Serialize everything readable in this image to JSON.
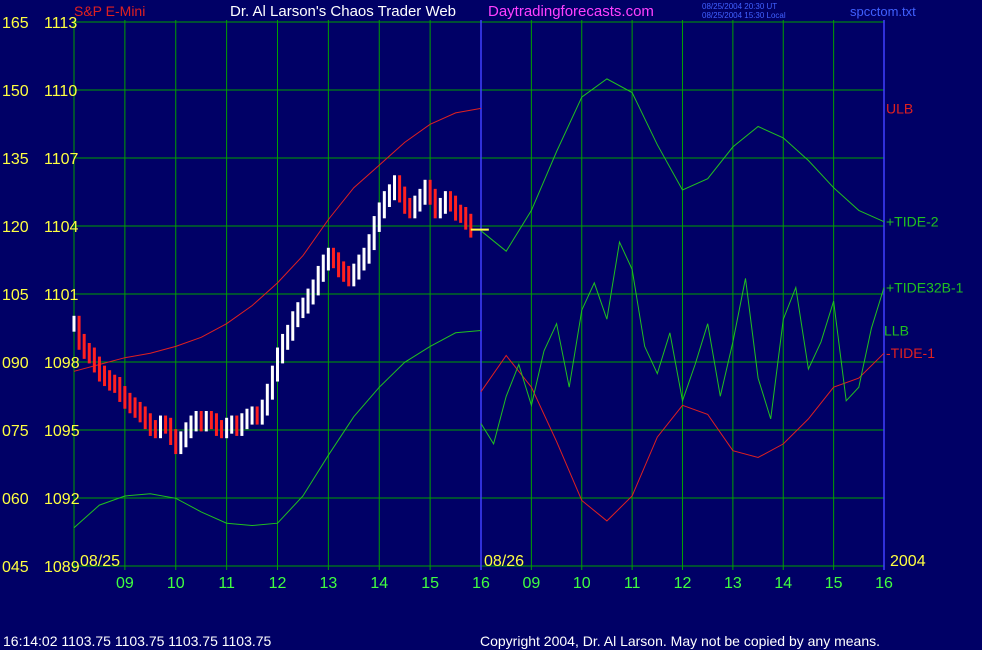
{
  "header": {
    "symbol": "S&P E-Mini",
    "title": "Dr. Al Larson's Chaos Trader Web",
    "site": "Daytradingforecasts.com",
    "timestamp_ut": "08/25/2004 20:30 UT",
    "timestamp_local": "08/25/2004 15:30 Local",
    "file": "spcctom.txt"
  },
  "footer": {
    "quote": "16:14:02  1103.75 1103.75 1103.75 1103.75",
    "copyright": "Copyright 2004, Dr. Al Larson. May not be copied by any means."
  },
  "colors": {
    "background": "#000066",
    "grid": "#00a000",
    "divider": "#4040ff",
    "bar_up": "#ffffff",
    "bar_down": "#ff2020",
    "series_red": "#e02020",
    "series_green": "#20c020",
    "series_blue": "#2040ff",
    "label_yellow": "#ffff40",
    "label_green": "#40ff40",
    "title_magenta": "#ff40ff"
  },
  "chart_data": {
    "type": "line",
    "title": "S&P E-Mini",
    "left_axis_ticks": [
      "165",
      "150",
      "135",
      "120",
      "105",
      "090",
      "075",
      "060",
      "045"
    ],
    "price_axis_ticks": [
      "1113",
      "1110",
      "1107",
      "1104",
      "1101",
      "1098",
      "1095",
      "1092",
      "1089"
    ],
    "ylim_price": [
      1089,
      1113
    ],
    "ylim_index": [
      45,
      165
    ],
    "x_ticks": [
      "09",
      "10",
      "11",
      "12",
      "13",
      "14",
      "15",
      "16",
      "09",
      "10",
      "11",
      "12",
      "13",
      "14",
      "15",
      "16"
    ],
    "day_labels": [
      "08/25",
      "08/26"
    ],
    "year": "2004",
    "last_price": 1103.75,
    "xlim_hours": [
      8.0,
      16.0
    ],
    "price_bars": [
      {
        "t": 8.0,
        "c": 1099.6
      },
      {
        "t": 8.1,
        "c": 1098.8
      },
      {
        "t": 8.2,
        "c": 1098.4
      },
      {
        "t": 8.3,
        "c": 1098.2
      },
      {
        "t": 8.4,
        "c": 1097.8
      },
      {
        "t": 8.5,
        "c": 1097.4
      },
      {
        "t": 8.6,
        "c": 1097.2
      },
      {
        "t": 8.7,
        "c": 1097.0
      },
      {
        "t": 8.8,
        "c": 1096.9
      },
      {
        "t": 8.9,
        "c": 1096.5
      },
      {
        "t": 9.0,
        "c": 1096.2
      },
      {
        "t": 9.1,
        "c": 1096.0
      },
      {
        "t": 9.2,
        "c": 1095.8
      },
      {
        "t": 9.3,
        "c": 1095.6
      },
      {
        "t": 9.4,
        "c": 1095.3
      },
      {
        "t": 9.5,
        "c": 1095.0
      },
      {
        "t": 9.6,
        "c": 1094.9
      },
      {
        "t": 9.7,
        "c": 1095.2
      },
      {
        "t": 9.8,
        "c": 1095.1
      },
      {
        "t": 9.9,
        "c": 1094.6
      },
      {
        "t": 10.0,
        "c": 1094.2
      },
      {
        "t": 10.1,
        "c": 1094.5
      },
      {
        "t": 10.2,
        "c": 1094.9
      },
      {
        "t": 10.3,
        "c": 1095.2
      },
      {
        "t": 10.4,
        "c": 1095.4
      },
      {
        "t": 10.5,
        "c": 1095.2
      },
      {
        "t": 10.6,
        "c": 1095.4
      },
      {
        "t": 10.7,
        "c": 1095.3
      },
      {
        "t": 10.8,
        "c": 1095.0
      },
      {
        "t": 10.9,
        "c": 1094.9
      },
      {
        "t": 11.0,
        "c": 1095.1
      },
      {
        "t": 11.1,
        "c": 1095.2
      },
      {
        "t": 11.2,
        "c": 1095.0
      },
      {
        "t": 11.3,
        "c": 1095.3
      },
      {
        "t": 11.4,
        "c": 1095.5
      },
      {
        "t": 11.5,
        "c": 1095.6
      },
      {
        "t": 11.6,
        "c": 1095.5
      },
      {
        "t": 11.7,
        "c": 1095.9
      },
      {
        "t": 11.8,
        "c": 1096.6
      },
      {
        "t": 11.9,
        "c": 1097.4
      },
      {
        "t": 12.0,
        "c": 1098.2
      },
      {
        "t": 12.1,
        "c": 1098.8
      },
      {
        "t": 12.2,
        "c": 1099.2
      },
      {
        "t": 12.3,
        "c": 1099.8
      },
      {
        "t": 12.4,
        "c": 1100.2
      },
      {
        "t": 12.5,
        "c": 1100.4
      },
      {
        "t": 12.6,
        "c": 1100.8
      },
      {
        "t": 12.7,
        "c": 1101.2
      },
      {
        "t": 12.8,
        "c": 1101.8
      },
      {
        "t": 12.9,
        "c": 1102.3
      },
      {
        "t": 13.0,
        "c": 1102.6
      },
      {
        "t": 13.1,
        "c": 1102.4
      },
      {
        "t": 13.2,
        "c": 1102.0
      },
      {
        "t": 13.3,
        "c": 1101.8
      },
      {
        "t": 13.4,
        "c": 1101.6
      },
      {
        "t": 13.5,
        "c": 1101.9
      },
      {
        "t": 13.6,
        "c": 1102.3
      },
      {
        "t": 13.7,
        "c": 1102.6
      },
      {
        "t": 13.8,
        "c": 1103.2
      },
      {
        "t": 13.9,
        "c": 1104.0
      },
      {
        "t": 14.0,
        "c": 1104.6
      },
      {
        "t": 14.1,
        "c": 1105.1
      },
      {
        "t": 14.2,
        "c": 1105.4
      },
      {
        "t": 14.3,
        "c": 1105.8
      },
      {
        "t": 14.4,
        "c": 1105.3
      },
      {
        "t": 14.5,
        "c": 1104.8
      },
      {
        "t": 14.6,
        "c": 1104.6
      },
      {
        "t": 14.7,
        "c": 1104.9
      },
      {
        "t": 14.8,
        "c": 1105.2
      },
      {
        "t": 14.9,
        "c": 1105.6
      },
      {
        "t": 15.0,
        "c": 1105.2
      },
      {
        "t": 15.1,
        "c": 1104.6
      },
      {
        "t": 15.2,
        "c": 1104.8
      },
      {
        "t": 15.3,
        "c": 1105.1
      },
      {
        "t": 15.4,
        "c": 1104.9
      },
      {
        "t": 15.5,
        "c": 1104.5
      },
      {
        "t": 15.6,
        "c": 1104.4
      },
      {
        "t": 15.7,
        "c": 1104.1
      },
      {
        "t": 15.8,
        "c": 1103.75
      }
    ],
    "series": [
      {
        "name": "ULB",
        "color": "red",
        "y_axis": "price",
        "day": 1,
        "x": [
          8.0,
          8.5,
          9.0,
          9.5,
          10.0,
          10.5,
          11.0,
          11.5,
          12.0,
          12.5,
          13.0,
          13.5,
          14.0,
          14.5,
          15.0,
          15.5,
          16.0
        ],
        "y": [
          1097.5,
          1097.8,
          1098.1,
          1098.3,
          1098.6,
          1099.0,
          1099.6,
          1100.4,
          1101.4,
          1102.6,
          1104.2,
          1105.6,
          1106.6,
          1107.6,
          1108.4,
          1108.9,
          1109.1
        ]
      },
      {
        "name": "LLB",
        "color": "green",
        "y_axis": "price",
        "day": 1,
        "x": [
          8.0,
          8.5,
          9.0,
          9.5,
          10.0,
          10.5,
          11.0,
          11.5,
          12.0,
          12.5,
          13.0,
          13.5,
          14.0,
          14.5,
          15.0,
          15.5,
          16.0
        ],
        "y": [
          1090.6,
          1091.6,
          1092.0,
          1092.1,
          1091.9,
          1091.3,
          1090.8,
          1090.7,
          1090.8,
          1092.0,
          1093.8,
          1095.5,
          1096.8,
          1097.9,
          1098.6,
          1099.2,
          1099.3
        ]
      },
      {
        "name": "-TIDE-1",
        "color": "red",
        "y_axis": "price",
        "day": 2,
        "x": [
          8.0,
          8.5,
          9.0,
          9.5,
          10.0,
          10.5,
          11.0,
          11.5,
          12.0,
          12.5,
          13.0,
          13.5,
          14.0,
          14.5,
          15.0,
          15.5,
          16.0
        ],
        "y": [
          1096.6,
          1098.2,
          1096.8,
          1094.4,
          1091.8,
          1090.9,
          1092.0,
          1094.6,
          1096.0,
          1095.6,
          1094.0,
          1093.7,
          1094.3,
          1095.4,
          1096.8,
          1097.2,
          1098.3
        ]
      },
      {
        "name": "+TIDE-2",
        "color": "green",
        "y_axis": "price",
        "day": 2,
        "x": [
          8.0,
          8.5,
          9.0,
          9.5,
          10.0,
          10.5,
          11.0,
          11.5,
          12.0,
          12.5,
          13.0,
          13.5,
          14.0,
          14.5,
          15.0,
          15.5,
          16.0
        ],
        "y": [
          1103.7,
          1102.8,
          1104.6,
          1107.2,
          1109.6,
          1110.4,
          1109.8,
          1107.5,
          1105.5,
          1106.0,
          1107.4,
          1108.3,
          1107.8,
          1106.8,
          1105.6,
          1104.6,
          1104.1
        ]
      },
      {
        "name": "+TIDE32B-1",
        "color": "green",
        "y_axis": "price",
        "day": 2,
        "x": [
          8.0,
          8.25,
          8.5,
          8.75,
          9.0,
          9.25,
          9.5,
          9.75,
          10.0,
          10.25,
          10.5,
          10.75,
          11.0,
          11.25,
          11.5,
          11.75,
          12.0,
          12.25,
          12.5,
          12.75,
          13.0,
          13.25,
          13.5,
          13.75,
          14.0,
          14.25,
          14.5,
          14.75,
          15.0,
          15.25,
          15.5,
          15.75,
          16.0
        ],
        "y": [
          1095.2,
          1094.3,
          1096.4,
          1097.8,
          1096.0,
          1098.4,
          1099.6,
          1096.8,
          1100.2,
          1101.4,
          1099.8,
          1103.2,
          1102.0,
          1098.6,
          1097.4,
          1099.2,
          1096.2,
          1097.8,
          1099.6,
          1096.4,
          1098.8,
          1101.6,
          1097.2,
          1095.4,
          1099.8,
          1101.2,
          1097.6,
          1098.8,
          1100.6,
          1096.2,
          1096.8,
          1099.4,
          1101.2
        ]
      }
    ],
    "legend": [
      "ULB",
      "+TIDE32B-1",
      "LLB",
      "-TIDE-1",
      "+TIDE-2"
    ]
  }
}
